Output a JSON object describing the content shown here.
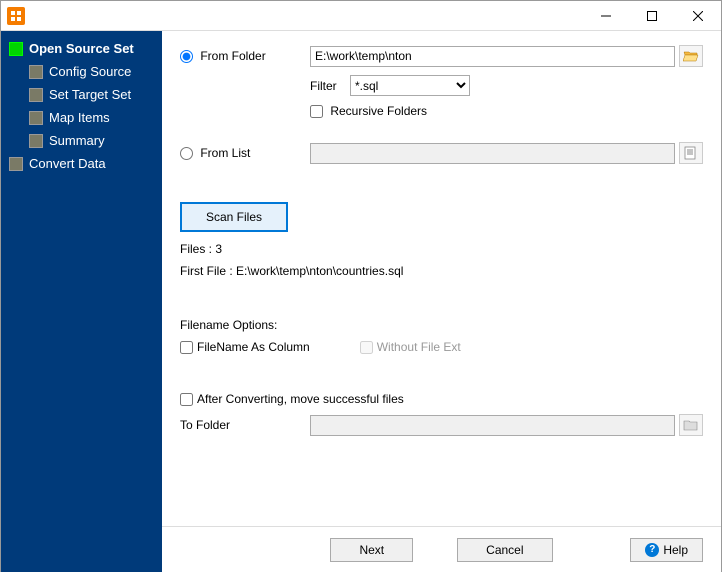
{
  "titlebar": {
    "title": ""
  },
  "sidebar": {
    "items": [
      {
        "label": "Open Source Set",
        "active": true,
        "depth": 0
      },
      {
        "label": "Config Source",
        "active": false,
        "depth": 1
      },
      {
        "label": "Set Target Set",
        "active": false,
        "depth": 1
      },
      {
        "label": "Map Items",
        "active": false,
        "depth": 1
      },
      {
        "label": "Summary",
        "active": false,
        "depth": 1
      },
      {
        "label": "Convert Data",
        "active": false,
        "depth": 0
      }
    ]
  },
  "main": {
    "from_folder_label": "From Folder",
    "from_folder_value": "E:\\work\\temp\\nton",
    "filter_label": "Filter",
    "filter_selected": "*.sql",
    "filter_options": [
      "*.sql"
    ],
    "recursive_label": "Recursive Folders",
    "recursive_checked": false,
    "from_list_label": "From List",
    "from_list_value": "",
    "scan_label": "Scan Files",
    "files_count_label": "Files : 3",
    "first_file_label": "First File : E:\\work\\temp\\nton\\countries.sql",
    "filename_options_label": "Filename Options:",
    "filename_as_column_label": "FileName As Column",
    "filename_as_column_checked": false,
    "without_ext_label": "Without File Ext",
    "without_ext_checked": false,
    "after_convert_label": "After Converting, move successful files",
    "after_convert_checked": false,
    "to_folder_label": "To Folder",
    "to_folder_value": ""
  },
  "buttons": {
    "next": "Next",
    "cancel": "Cancel",
    "help": "Help"
  }
}
